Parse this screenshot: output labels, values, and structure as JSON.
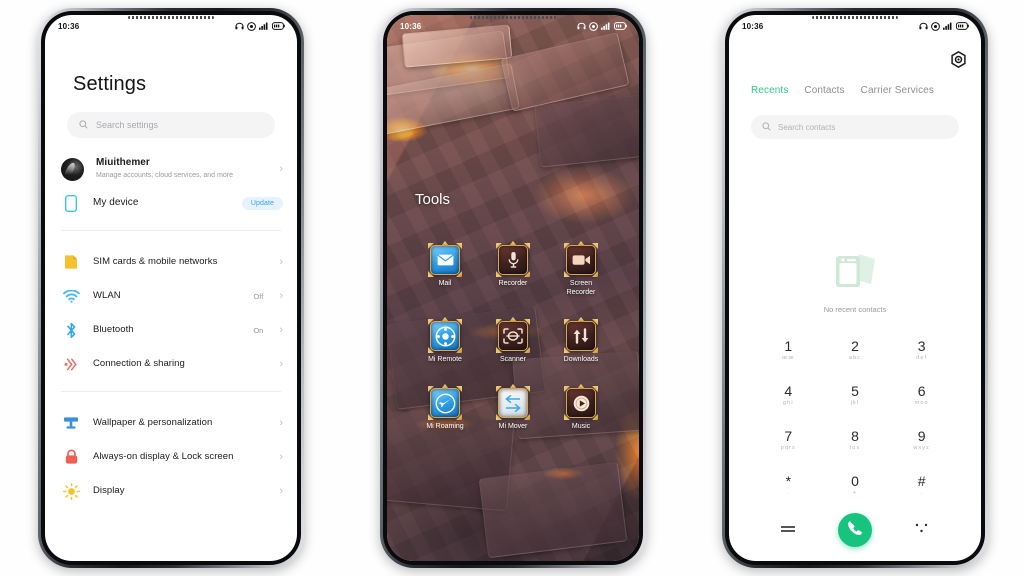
{
  "status_bar": {
    "time": "10:36",
    "icons": [
      "headset-icon",
      "dnd-icon",
      "signal-icon",
      "battery-icon"
    ]
  },
  "phone1": {
    "title": "Settings",
    "search": {
      "placeholder": "Search settings",
      "icon": "search-icon"
    },
    "account": {
      "name": "Miuithemer",
      "subtitle": "Manage accounts, cloud services, and more",
      "avatar": "account-avatar"
    },
    "device": {
      "label": "My device",
      "badge": "Update",
      "icon": "phone-icon"
    },
    "items": [
      {
        "label": "SIM cards & mobile networks",
        "value": "",
        "icon": "sim-icon"
      },
      {
        "label": "WLAN",
        "value": "Off",
        "icon": "wifi-icon"
      },
      {
        "label": "Bluetooth",
        "value": "On",
        "icon": "bluetooth-icon"
      },
      {
        "label": "Connection & sharing",
        "value": "",
        "icon": "connection-icon"
      }
    ],
    "items2": [
      {
        "label": "Wallpaper & personalization",
        "value": "",
        "icon": "wallpaper-icon"
      },
      {
        "label": "Always-on display & Lock screen",
        "value": "",
        "icon": "lock-icon"
      },
      {
        "label": "Display",
        "value": "",
        "icon": "brightness-icon"
      }
    ],
    "chevron": "›"
  },
  "phone2": {
    "folder_title": "Tools",
    "apps": [
      {
        "name": "Mail",
        "icon": "mail-icon"
      },
      {
        "name": "Recorder",
        "icon": "microphone-icon"
      },
      {
        "name": "Screen Recorder",
        "icon": "video-camera-icon"
      },
      {
        "name": "Mi Remote",
        "icon": "remote-control-icon"
      },
      {
        "name": "Scanner",
        "icon": "scan-frame-icon"
      },
      {
        "name": "Downloads",
        "icon": "download-arrows-icon"
      },
      {
        "name": "Mi Roaming",
        "icon": "airplane-globe-icon"
      },
      {
        "name": "Mi Mover",
        "icon": "transfer-arrows-icon"
      },
      {
        "name": "Music",
        "icon": "music-play-icon"
      }
    ]
  },
  "phone3": {
    "settings_icon": "gear-icon",
    "tabs": [
      {
        "label": "Recents",
        "active": true
      },
      {
        "label": "Contacts",
        "active": false
      },
      {
        "label": "Carrier Services",
        "active": false
      }
    ],
    "search": {
      "placeholder": "Search contacts",
      "icon": "search-icon"
    },
    "empty_state": {
      "caption": "No recent contacts",
      "icon": "contact-card-icon"
    },
    "keypad": [
      {
        "num": "1",
        "letters": "œœ"
      },
      {
        "num": "2",
        "letters": "abc"
      },
      {
        "num": "3",
        "letters": "def"
      },
      {
        "num": "4",
        "letters": "ghi"
      },
      {
        "num": "5",
        "letters": "jkl"
      },
      {
        "num": "6",
        "letters": "mno"
      },
      {
        "num": "7",
        "letters": "pqrs"
      },
      {
        "num": "8",
        "letters": "tuv"
      },
      {
        "num": "9",
        "letters": "wxyz"
      },
      {
        "num": "*",
        "letters": "."
      },
      {
        "num": "0",
        "letters": "+"
      },
      {
        "num": "#",
        "letters": "."
      }
    ],
    "actions": {
      "menu_icon": "menu-lines-icon",
      "call_icon": "phone-call-icon",
      "hide_icon": "hide-dialpad-icon"
    },
    "accent": "#2ecc82",
    "call_button_color": "#16c47f"
  }
}
